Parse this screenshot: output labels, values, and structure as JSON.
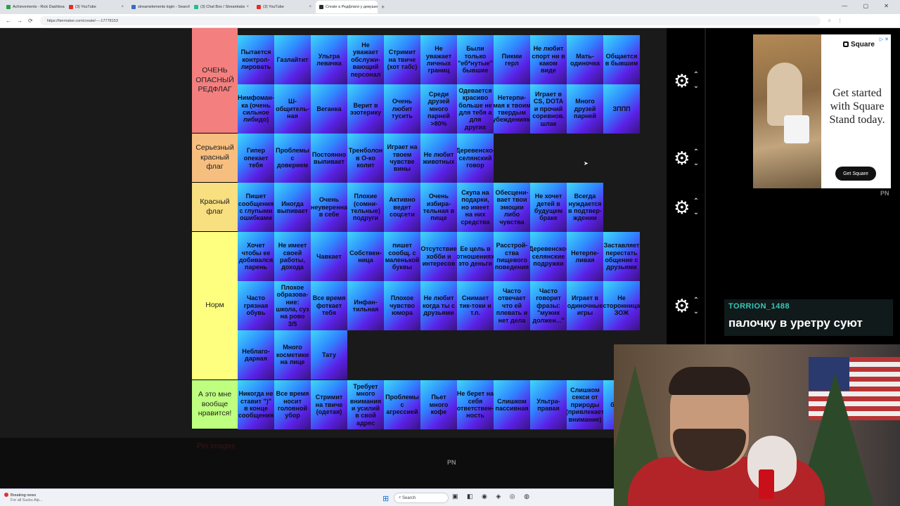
{
  "browser": {
    "tabs": [
      {
        "label": "Achievements - Rick Dashboard",
        "color": "#2e9e48",
        "active": false
      },
      {
        "label": "(3) YouTube",
        "color": "#e52d27",
        "active": false
      },
      {
        "label": "streamelements login - Search",
        "color": "#3b6cc4",
        "active": false
      },
      {
        "label": "(3) Chat Box / Streamlabs",
        "color": "#1fbf8f",
        "active": false
      },
      {
        "label": "(3) YouTube",
        "color": "#e52d27",
        "active": false
      },
      {
        "label": "Create a Редфлаги у девушек Ti...",
        "color": "#2d2d2d",
        "active": true
      }
    ],
    "new_tab": "+",
    "url": "https://tiermaker.com/create/----17778153"
  },
  "tiers": [
    {
      "label": "ОЧЕНЬ ОПАСНЫЙ РЕДФЛАГ",
      "color": "#f47f7f",
      "items": [
        "Пытается контрол-лировать",
        "Газлайтит",
        "Ультра левачка",
        "Не уважает обслужи-вающий персонал",
        "Стримит на твиче (хот табс)",
        "Не уважает личных границ",
        "Были только \"еб*нутые\" бывшие",
        "Пикми герл",
        "Не любит спорт ни в каком виде",
        "Мать-одиночка",
        "Общается в бывшим",
        "Нимфоман-ка (очень сильное либидо)",
        "Ш-общитель-ная",
        "Веганка",
        "Верит в эзотерику",
        "Очень любит тусить",
        "Среди друзей много парней >80%",
        "Одевается красиво больше не для тебя а для других",
        "Нетерпи-мая к твоим твердым убеждениям",
        "Играет в CS, DOTA и прочий соревнов. шлак",
        "Много друзей парней",
        "ЗППП"
      ]
    },
    {
      "label": "Серьезный красный флаг",
      "color": "#f7bf7f",
      "items": [
        "Гипер опекает тебя",
        "Проблемы с доверием",
        "Постоянно выпивает",
        "Тренболон в О-ко колит",
        "Играет на твоем чувстве вины",
        "Не любит животных",
        "Деревенско-селянский говор"
      ]
    },
    {
      "label": "Красный флаг",
      "color": "#f8df80",
      "items": [
        "Пишет сообщения с глупыми ошибками",
        "Иногда выпивает",
        "Очень неуверенна в себе",
        "Плохие (сомни-тельные) подруги",
        "Активно ведет соцсети",
        "Очень избира-тельная в пище",
        "Скупа на подарки, но имеет на них средства",
        "Обесцени-вает твои эмоции либо чувства",
        "Не хочет детей в будущем браке",
        "Всегда нуждается в подтвер-ждении"
      ]
    },
    {
      "label": "Норм",
      "color": "#ffff7f",
      "items": [
        "Хочет чтобы ее добивался парень",
        "Не имеет своей работы, дохода",
        "Чавкает",
        "Собствен-ница",
        "пишет сообщ. с маленькой буквы",
        "Отсутствие хобби и интересов",
        "Ее цель в отношениях это деньги",
        "Расстрой-ства пищевого поведения",
        "Деревенско-селянские подружки",
        "Нетерпе-ливая",
        "Заставляет перестать общение с друзьями",
        "Часто грязная обувь",
        "Плохое образова-ние: школа, суз на рово 3/5",
        "Все время фоткает тебя",
        "Инфан-тильная",
        "Плохое чувство юмора",
        "Не любит когда ты с друзьями",
        "Снимает тик-токи и т.п.",
        "Часто отвечает что ей плевать и нет дела",
        "Часто говорит фразы: \"мужик должен...\"",
        "Играет в одиночные игры",
        "Не сторонница ЗОЖ",
        "Неблаго-дарная",
        "Много косметики на лице",
        "Тату"
      ]
    },
    {
      "label": "А это мне вообще нравится!",
      "color": "#bfff7f",
      "items": [
        "Никогда не ставит \")\" в конце сообщения",
        "Все время носит головной убор",
        "Стримит на твиче (одетая)",
        "Требует много внимания и усилий в свой адрес",
        "Проблемы с агрессией",
        "Пьет много кофе",
        "Не берет на себя ответствен-ность",
        "Слишком пассивная",
        "Ультра-правая",
        "Слишком секси от природы (привлекает внимание)",
        "бе ТГ У"
      ]
    }
  ],
  "controls": {
    "gear_icon": "⚙",
    "up_icon": "⌃",
    "down_icon": "⌄"
  },
  "pin_images": "Pin images",
  "watermark": "PN",
  "ad": {
    "brand": "Square",
    "headline": "Get started with Square Stand today.",
    "button": "Get Square",
    "badge": "▷ ✕"
  },
  "chat": {
    "username": "TORRION_1488",
    "message": "палочку в уретру суют"
  },
  "taskbar": {
    "news_title": "Breaking news",
    "news_sub": "For all Sucks Alp...",
    "search": "Search"
  }
}
